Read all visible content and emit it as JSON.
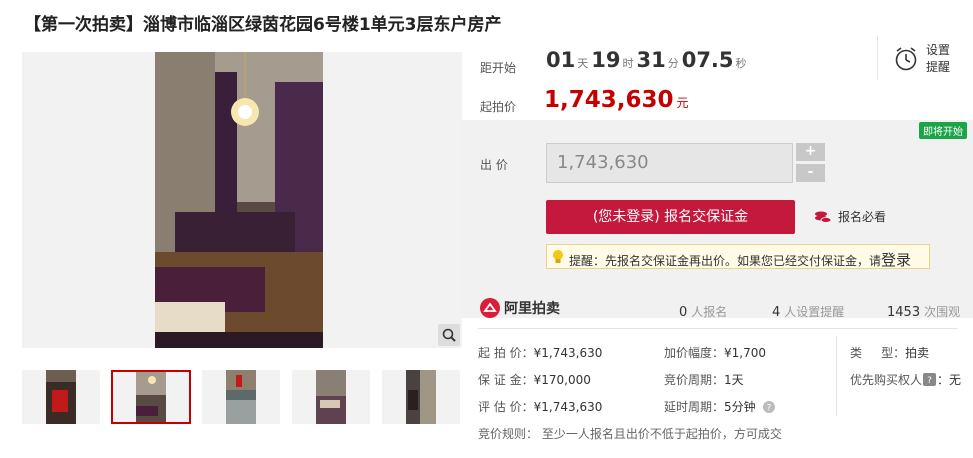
{
  "title": "【第一次拍卖】淄博市临淄区绿茵花园6号楼1单元3层东户房产",
  "countdown": {
    "label": "距开始",
    "days": "01",
    "days_unit": "天",
    "hours": "19",
    "hours_unit": "时",
    "minutes": "31",
    "minutes_unit": "分",
    "seconds": "07.5",
    "seconds_unit": "秒"
  },
  "start_price": {
    "label": "起拍价",
    "value": "1,743,630",
    "unit": "元"
  },
  "reminder": {
    "line1": "设置",
    "line2": "提醒"
  },
  "badge": "即将开始",
  "bid": {
    "label": "出  价",
    "value": "1,743,630",
    "plus": "+",
    "minus": "-"
  },
  "signup_button": "(您未登录) 报名交保证金",
  "must_read": "报名必看",
  "tip": {
    "text": "提醒：先报名交保证金再出价。如果您已经交付保证金，请",
    "link": "登录"
  },
  "brand": "阿里拍卖",
  "stats": [
    {
      "num": "0",
      "label": "人报名"
    },
    {
      "num": "4",
      "label": "人设置提醒"
    },
    {
      "num": "1453",
      "label": "次围观"
    }
  ],
  "info": {
    "start_price": {
      "k": "起 拍 价：",
      "v": "¥1,743,630"
    },
    "deposit": {
      "k": "保 证 金：",
      "v": "¥170,000"
    },
    "appraisal": {
      "k": "评 估 价：",
      "v": "¥1,743,630"
    },
    "increment": {
      "k": "加价幅度：",
      "v": "¥1,700"
    },
    "cycle": {
      "k": "竞价周期：",
      "v": "1天"
    },
    "extension": {
      "k": "延时周期：",
      "v": "5分钟"
    },
    "type": {
      "k": "类     型：",
      "v": "拍卖"
    },
    "priority": {
      "k": "优先购买权人",
      "v": "：无"
    },
    "rule": "竞价规则：  至少一人报名且出价不低于起拍价，方可成交"
  }
}
